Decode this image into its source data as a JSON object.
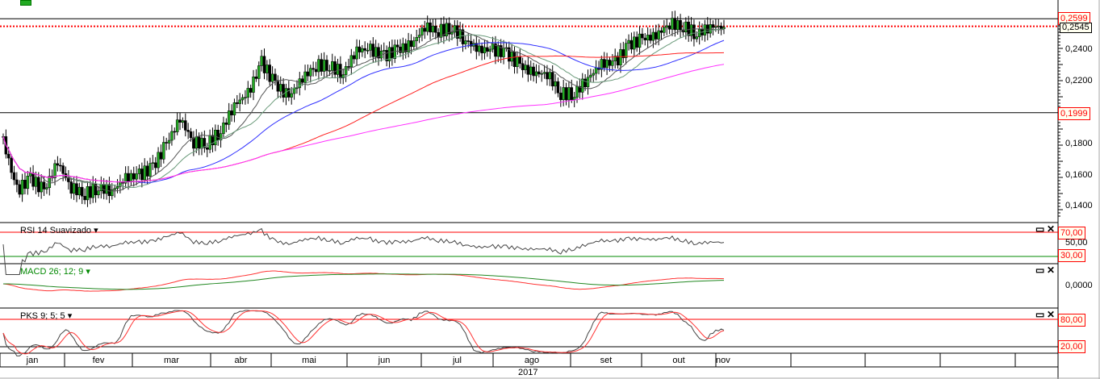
{
  "chart_data": {
    "type": "candlestick",
    "year": "2017",
    "months": [
      "jan",
      "fev",
      "mar",
      "abr",
      "mai",
      "jun",
      "jul",
      "ago",
      "set",
      "out",
      "nov"
    ],
    "price_axis": {
      "ticks": [
        "0,1400",
        "0,1600",
        "0,1800",
        "0,2200",
        "0,2400"
      ],
      "tick_values": [
        0.14,
        0.16,
        0.18,
        0.22,
        0.24
      ],
      "ylim": [
        0.13,
        0.265
      ]
    },
    "levels": [
      {
        "label": "0,2599",
        "value": 0.2599
      },
      {
        "label": "0,1999",
        "value": 0.1999
      }
    ],
    "last_price": {
      "label": "0,2545",
      "value": 0.2545
    },
    "close": [
      0.182,
      0.15,
      0.158,
      0.15,
      0.168,
      0.152,
      0.148,
      0.152,
      0.15,
      0.158,
      0.16,
      0.165,
      0.18,
      0.196,
      0.181,
      0.18,
      0.188,
      0.205,
      0.212,
      0.232,
      0.218,
      0.21,
      0.222,
      0.23,
      0.23,
      0.225,
      0.24,
      0.24,
      0.236,
      0.24,
      0.243,
      0.255,
      0.252,
      0.254,
      0.246,
      0.24,
      0.24,
      0.238,
      0.23,
      0.225,
      0.225,
      0.212,
      0.212,
      0.222,
      0.231,
      0.232,
      0.243,
      0.247,
      0.249,
      0.257,
      0.255,
      0.25,
      0.255,
      0.2545
    ],
    "moving_averages": [
      {
        "period": 3,
        "color": "#555555"
      },
      {
        "period": 5,
        "color": "#6a9a7a"
      },
      {
        "period": 10,
        "color": "#3030ff"
      },
      {
        "period": 20,
        "color": "#ff2020"
      },
      {
        "period": 40,
        "color": "#ff30ff"
      }
    ],
    "indicators": {
      "rsi": {
        "label": "RSI 14 Suavizado",
        "upper": "70,00",
        "mid": "50,00",
        "lower": "30,00"
      },
      "macd": {
        "label": "MACD 26; 12; 9",
        "zero": "0,0000"
      },
      "pks": {
        "label": "PKS 9; 5; 5",
        "upper": "80,00",
        "lower": "20,00"
      }
    },
    "colors": {
      "up": "#22aa22",
      "down": "#000000",
      "level": "#ff0000"
    }
  }
}
